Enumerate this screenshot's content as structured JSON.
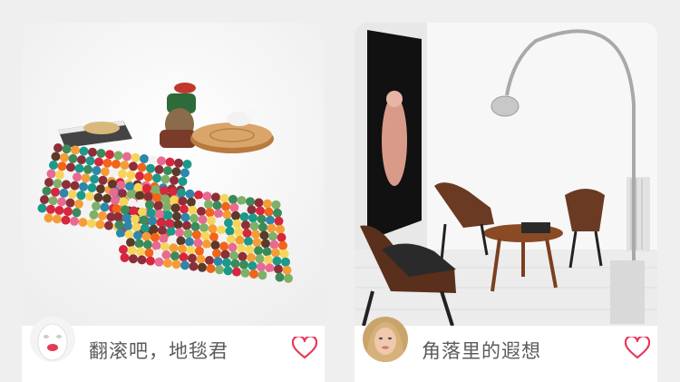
{
  "cards": [
    {
      "title": "翻滚吧，地毯君",
      "image": "colorful-felt-ball-rug-photo",
      "avatar": "white-sculpture-face-avatar",
      "like_icon": "heart-outline-icon",
      "accent": "#e8375a"
    },
    {
      "title": "角落里的遐想",
      "image": "modern-room-with-arc-lamp-photo",
      "avatar": "blonde-woman-avatar",
      "like_icon": "heart-outline-icon",
      "accent": "#e8375a"
    }
  ]
}
